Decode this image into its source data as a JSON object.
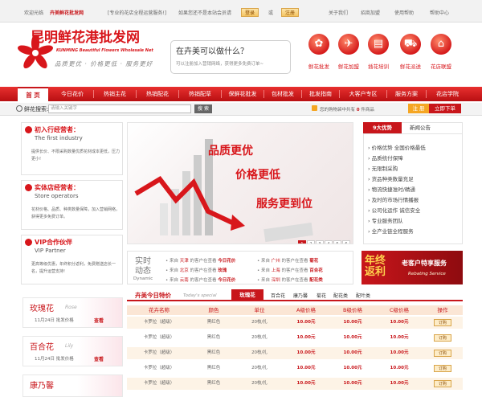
{
  "topbar": {
    "welcome": "欢迎光临",
    "site_name": "卉美鲜花批发网",
    "tagline": "[专业的花店全程运营服务!]",
    "prompt": "如果您还不是本站会员请",
    "login_label": "登录",
    "or_label": "或",
    "register_label": "注册",
    "links": [
      "关于我们",
      "招商加盟",
      "使用帮助",
      "帮助中心"
    ]
  },
  "header": {
    "logo_cn": "昆明鲜花港批发网",
    "logo_en": "KUNMING Beautiful Flowers Wholesale Net",
    "slogan": "品质更优 · 价格更低 · 服务更好",
    "speech_question": "在卉美可以做什么？",
    "speech_text": "可以注册加入营销网络，获得更多免费订单~",
    "icons": [
      {
        "label": "鲜花批发",
        "icon": "flower-icon"
      },
      {
        "label": "鲜花加盟",
        "icon": "plane-icon"
      },
      {
        "label": "插花培训",
        "icon": "book-icon"
      },
      {
        "label": "鲜花派送",
        "icon": "cart-icon"
      },
      {
        "label": "花店联盟",
        "icon": "shop-icon"
      }
    ]
  },
  "nav": {
    "home": "首 页",
    "items": [
      "今日花价",
      "热销主花",
      "热销配花",
      "热销配草",
      "保鲜花批发",
      "包材批发",
      "批发指南",
      "大客户专区",
      "服务方案",
      "花店学院"
    ]
  },
  "search": {
    "label": "鲜花搜索:",
    "placeholder": "请输入关键字",
    "button": "搜 索",
    "cart_text": "您的购物袋中共有",
    "cart_count": "0",
    "cart_unit": "件商品",
    "register_button": "注 册",
    "buy_button": "立即下单"
  },
  "left_boxes": [
    {
      "title": "初入行经营者：",
      "subtitle": "The first industry",
      "desc": "提供长价、不限采购数量优质花材成本更低，压力更小!"
    },
    {
      "title": "实体店经营者：",
      "subtitle": "Store operators",
      "desc": "花材价格、品质、种类数量保障，加入营销网络，获得更多免费订单。"
    },
    {
      "title": "VIP合作伙伴",
      "subtitle": "VIP Partner",
      "desc": "更高等级优惠，年终积分返利，免费赠送店长一名，提升运营支持!"
    }
  ],
  "banner": {
    "line1": "品质更优",
    "line2": "价格更低",
    "line3": "服务更到位",
    "pages": [
      "1",
      "2",
      "3",
      "4",
      "5",
      "6"
    ],
    "active_page": 0
  },
  "advantages": {
    "tab_active": "9大优势",
    "tab_other": "新闻公告",
    "items": [
      "价格优势 全国价格最低",
      "品质统付保障",
      "无限制采购",
      "货品种类数量充足",
      "物流快捷准时/精通",
      "及时的市场行情播报",
      "公司化运作 诚信安全",
      "专业服务团队",
      "全产业链全程服务"
    ]
  },
  "realtime": {
    "title1": "实时",
    "title2": "动态",
    "title_en": "Dynamic",
    "rows": [
      {
        "from": "来自",
        "city": "天津",
        "text": "的客户在查看",
        "item": "今日花价"
      },
      {
        "from": "来自",
        "city": "广州",
        "text": "的客户在查看",
        "item": "菊花"
      },
      {
        "from": "来自",
        "city": "北京",
        "text": "的客户在查看",
        "item": "玫瑰"
      },
      {
        "from": "来自",
        "city": "上海",
        "text": "的客户在查看",
        "item": "百合花"
      },
      {
        "from": "来自",
        "city": "云南",
        "text": "的客户在查看",
        "item": "今日花价"
      },
      {
        "from": "来自",
        "city": "深圳",
        "text": "的客户在查看",
        "item": "配花类"
      }
    ]
  },
  "promo": {
    "text_big": "年终返利",
    "text_main": "老客户特享服务",
    "text_en": "Rebating Service"
  },
  "flower_boxes": [
    {
      "name": "玫瑰花",
      "en": "Rose",
      "date": "11月24日",
      "status": "批发价格",
      "view": "查看"
    },
    {
      "name": "百合花",
      "en": "Lily",
      "date": "11月24日",
      "status": "批发价格",
      "view": "查看"
    },
    {
      "name": "康乃馨",
      "en": "",
      "date": "",
      "status": "",
      "view": ""
    }
  ],
  "price_table": {
    "title": "卉美今日特价",
    "title_en": "Today's special",
    "tabs": [
      "玫瑰花",
      "百合花",
      "康乃馨",
      "菊花",
      "配花类",
      "配叶类"
    ],
    "active_tab": 0,
    "headers": [
      "花卉名称",
      "颜色",
      "单位",
      "A级价格",
      "B级价格",
      "C级价格",
      "操作"
    ],
    "rows": [
      {
        "name": "卡罗拉（超级）",
        "color": "黑红色",
        "unit": "20枝/扎",
        "a": "10.00元",
        "b": "10.00元",
        "c": "10.00元",
        "op": "订购"
      },
      {
        "name": "卡罗拉（超级）",
        "color": "黑红色",
        "unit": "20枝/扎",
        "a": "10.00元",
        "b": "10.00元",
        "c": "10.00元",
        "op": "订购"
      },
      {
        "name": "卡罗拉（超级）",
        "color": "黑红色",
        "unit": "20枝/扎",
        "a": "10.00元",
        "b": "10.00元",
        "c": "10.00元",
        "op": "订购"
      },
      {
        "name": "卡罗拉（超级）",
        "color": "黑红色",
        "unit": "20枝/扎",
        "a": "10.00元",
        "b": "10.00元",
        "c": "10.00元",
        "op": "订购"
      },
      {
        "name": "卡罗拉（超级）",
        "color": "黑红色",
        "unit": "20枝/扎",
        "a": "10.00元",
        "b": "10.00元",
        "c": "10.00元",
        "op": "订购"
      }
    ]
  },
  "colors": {
    "brand": "#d8161b",
    "accent": "#f5a623"
  }
}
